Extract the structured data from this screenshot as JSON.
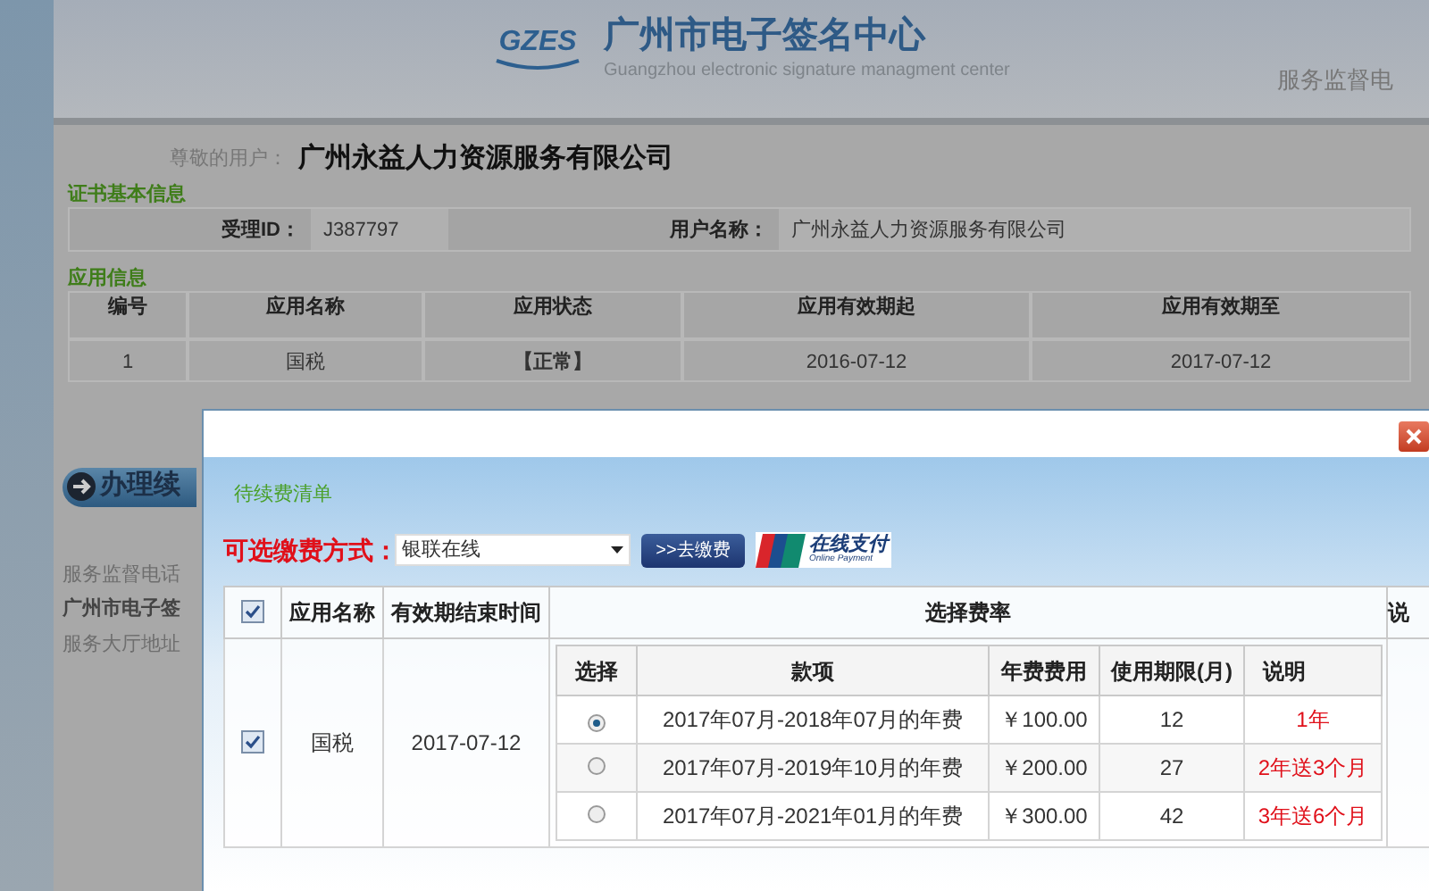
{
  "header": {
    "logo_text": "GZES",
    "title": "广州市电子签名中心",
    "subtitle": "Guangzhou electronic signature managment center",
    "hotline": "服务监督电"
  },
  "user": {
    "label": "尊敬的用户：",
    "name": "广州永益人力资源服务有限公司"
  },
  "cert_info": {
    "title": "证书基本信息",
    "fields": [
      {
        "label": "受理ID：",
        "value": "J387797"
      },
      {
        "label": "用户名称：",
        "value": "广州永益人力资源服务有限公司"
      }
    ]
  },
  "app_info": {
    "title": "应用信息",
    "columns": [
      "编号",
      "应用名称",
      "应用状态",
      "应用有效期起",
      "应用有效期至"
    ],
    "rows": [
      [
        "1",
        "国税",
        "【正常】",
        "2016-07-12",
        "2017-07-12"
      ]
    ]
  },
  "renew_button": "办理续",
  "sidebar_lines": [
    {
      "text": "服务监督电话",
      "bold": false
    },
    {
      "text": "广州市电子签",
      "bold": true
    },
    {
      "text": "服务大厅地址",
      "bold": false
    }
  ],
  "dialog": {
    "title": "待续费清单",
    "payment_label": "可选缴费方式：",
    "payment_select": "银联在线",
    "pay_button": ">>去缴费",
    "online_pay": {
      "title": "在线支付",
      "subtitle": "Online Payment"
    },
    "table": {
      "select_all_checked": true,
      "columns": [
        "应用名称",
        "有效期结束时间",
        "选择费率",
        "说"
      ],
      "rows": [
        {
          "checked": true,
          "app": "国税",
          "end_date": "2017-07-12",
          "rate_columns": [
            "选择",
            "款项",
            "年费费用",
            "使用期限(月)",
            "说明"
          ],
          "options": [
            {
              "selected": true,
              "item": "2017年07月-2018年07月的年费",
              "fee": "￥100.00",
              "months": "12",
              "note": "1年"
            },
            {
              "selected": false,
              "item": "2017年07月-2019年10月的年费",
              "fee": "￥200.00",
              "months": "27",
              "note": "2年送3个月"
            },
            {
              "selected": false,
              "item": "2017年07月-2021年01月的年费",
              "fee": "￥300.00",
              "months": "42",
              "note": "3年送6个月"
            }
          ]
        }
      ]
    }
  }
}
